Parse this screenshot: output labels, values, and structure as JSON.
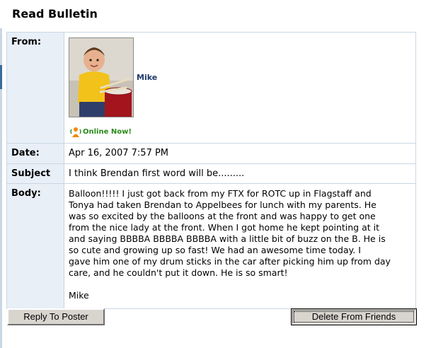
{
  "page": {
    "title": "Read Bulletin"
  },
  "labels": {
    "from": "From:",
    "date": "Date:",
    "subject": "Subject",
    "body": "Body:"
  },
  "sender": {
    "name": "Mike",
    "status": "Online Now!",
    "status_icon": "online-person-icon",
    "status_color": "#2a8a1a"
  },
  "bulletin": {
    "date": "Apr 16, 2007 7:57 PM",
    "subject": "I think Brendan first word will be.........",
    "body_lines": [
      "Balloon!!!!! I just got back from my FTX for ROTC up in Flagstaff and",
      "Tonya had taken Brendan to Appelbees for lunch with my parents. He",
      "was so excited by the balloons at the front and was happy to get one",
      "from the nice lady at the front. When I got home he kept pointing at it",
      "and saying BBBBA BBBBA BBBBA with a little bit of buzz on the B. He is",
      "so cute and growing up so fast! We had an awesome time today. I",
      "gave him one of my drum sticks in the car after picking him up from day",
      "care, and he couldn't put it down. He is so smart!"
    ],
    "signature": "Mike"
  },
  "buttons": {
    "reply": "Reply To Poster",
    "delete": "Delete From Friends"
  },
  "colors": {
    "label_bg": "#e8eff7",
    "border": "#c9d6e3",
    "name": "#1f3a6d"
  }
}
